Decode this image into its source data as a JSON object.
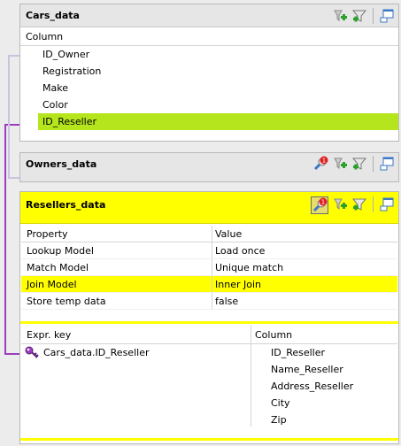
{
  "cars": {
    "title": "Cars_data",
    "column_header": "Column",
    "fields": [
      "ID_Owner",
      "Registration",
      "Make",
      "Color",
      "ID_Reseller"
    ]
  },
  "owners": {
    "title": "Owners_data"
  },
  "resellers": {
    "title": "Resellers_data",
    "badge": "1",
    "property_header": "Property",
    "value_header": "Value",
    "properties": [
      {
        "property": "Lookup Model",
        "value": "Load once"
      },
      {
        "property": "Match Model",
        "value": "Unique match"
      },
      {
        "property": "Join Model",
        "value": "Inner Join"
      },
      {
        "property": "Store temp data",
        "value": "false"
      }
    ],
    "expr_key_header": "Expr. key",
    "column_header": "Column",
    "expr_key": "Cars_data.ID_Reseller",
    "columns": [
      "ID_Reseller",
      "Name_Reseller",
      "Address_Reseller",
      "City",
      "Zip"
    ]
  },
  "owners_badge": "1",
  "icons": {
    "add": "add-filter-icon",
    "filter": "filter-icon",
    "minimize": "minimize-icon",
    "key": "key-icon",
    "lookup": "lookup-settings-icon"
  },
  "colors": {
    "selected_row": "#b5e61d",
    "lookup_header": "#ffff00",
    "link": "#9b3fbf"
  }
}
